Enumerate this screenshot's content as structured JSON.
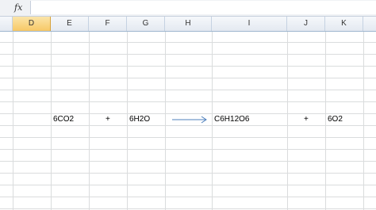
{
  "formula_bar": {
    "fx_label": "fx",
    "value": ""
  },
  "columns": [
    {
      "id": "D",
      "label": "D",
      "selected": true
    },
    {
      "id": "E",
      "label": "E"
    },
    {
      "id": "F",
      "label": "F"
    },
    {
      "id": "G",
      "label": "G"
    },
    {
      "id": "H",
      "label": "H"
    },
    {
      "id": "I",
      "label": "I"
    },
    {
      "id": "J",
      "label": "J"
    },
    {
      "id": "K",
      "label": "K"
    }
  ],
  "cells": {
    "e": "6CO2",
    "f": "+",
    "g": "6H2O",
    "i": "C6H12O6",
    "j": "+",
    "k": "6O2"
  },
  "arrow_icon": "right-arrow-icon",
  "colors": {
    "selected_header": "#f7c866",
    "arrow": "#4f81bd",
    "gridline": "#dadcdd"
  }
}
